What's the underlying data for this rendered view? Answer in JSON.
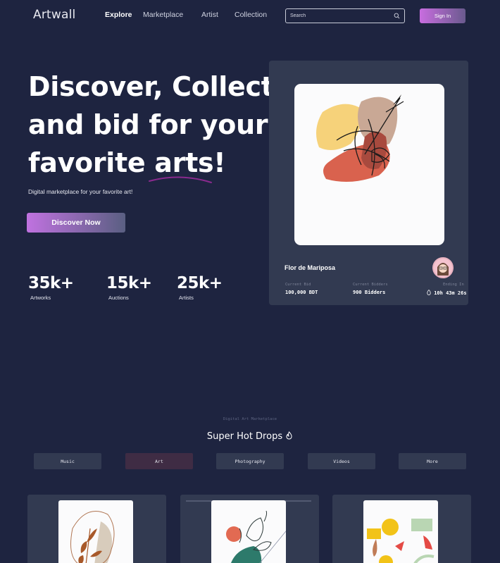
{
  "brand": {
    "logo": "Artwall"
  },
  "nav": {
    "items": [
      {
        "label": "Explore",
        "active": true
      },
      {
        "label": "Marketplace",
        "active": false
      },
      {
        "label": "Artist",
        "active": false
      },
      {
        "label": "Collection",
        "active": false
      }
    ],
    "search_placeholder": "Search",
    "signin_label": "Sign In"
  },
  "hero": {
    "title_line1": "Discover, Collect",
    "title_line2": "and bid for your",
    "title_line3a": "favorite ",
    "title_line3b": "arts!",
    "subtitle": "Digital marketplace for your favorite art!",
    "cta_label": "Discover Now",
    "stats": [
      {
        "value": "35k+",
        "label": "Artworks"
      },
      {
        "value": "15k+",
        "label": "Auctions"
      },
      {
        "value": "25k+",
        "label": "Artists"
      }
    ]
  },
  "featured": {
    "name": "Flor de Mariposa",
    "current_bid_label": "Current  Bid",
    "current_bid_value": "100,000 BDT",
    "bidders_label": "Current  Bidders",
    "bidders_value": "900 Bidders",
    "ending_label": "Ending In",
    "ending_value": "10h 43m 26s"
  },
  "drops": {
    "eyebrow": "Digital Art Marketplace",
    "title": "Super Hot Drops",
    "filters": [
      {
        "label": "Music",
        "active": false
      },
      {
        "label": "Art",
        "active": true
      },
      {
        "label": "Photography",
        "active": false
      },
      {
        "label": "Videos",
        "active": false
      },
      {
        "label": "More",
        "active": false
      }
    ]
  },
  "colors": {
    "background": "#1e2440",
    "card": "#323a51",
    "accent": "#c86ddf",
    "active_filter": "#3f2c44"
  },
  "icons": [
    "search-icon",
    "fire-icon",
    "timer-icon"
  ]
}
